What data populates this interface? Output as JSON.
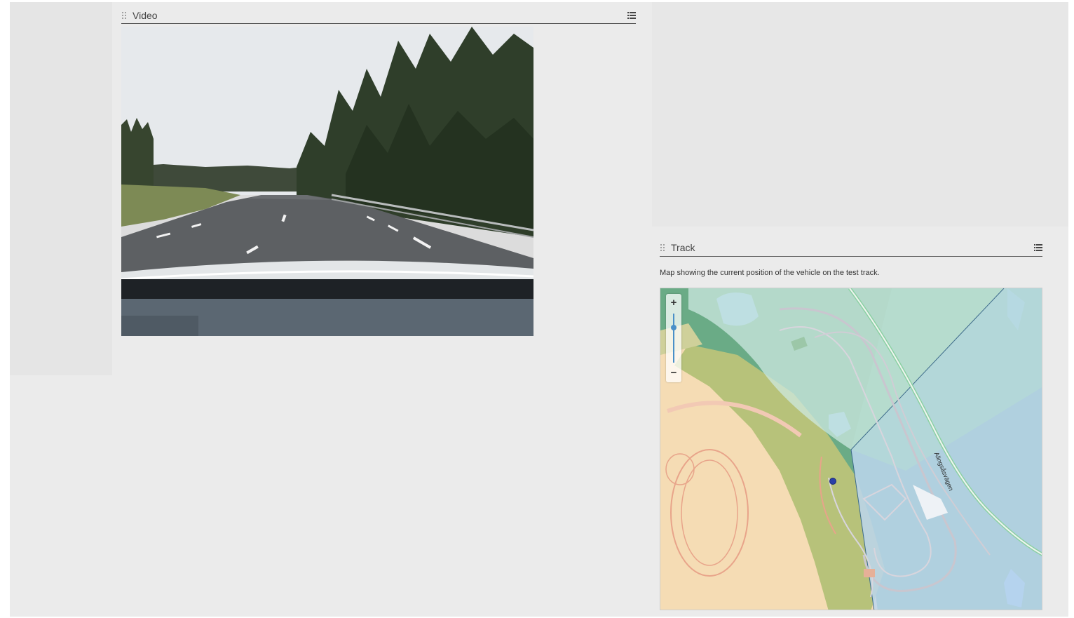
{
  "video_panel": {
    "title": "Video",
    "menu_icon": "list-menu-icon",
    "drag_icon": "drag-handle-icon"
  },
  "track_panel": {
    "title": "Track",
    "menu_icon": "list-menu-icon",
    "drag_icon": "drag-handle-icon",
    "caption": "Map showing the current position of the vehicle on the test track.",
    "map": {
      "zoom_in_label": "+",
      "zoom_out_label": "−",
      "street_label": "Alingsåsvägen",
      "vehicle_marker_color": "#2a3fa8"
    }
  },
  "colors": {
    "background": "#ebebeb",
    "map_forest": "#6aab86",
    "map_sand": "#f5dcb4",
    "map_water": "#8fc4e6",
    "map_overlay": "#bcd6ee"
  }
}
